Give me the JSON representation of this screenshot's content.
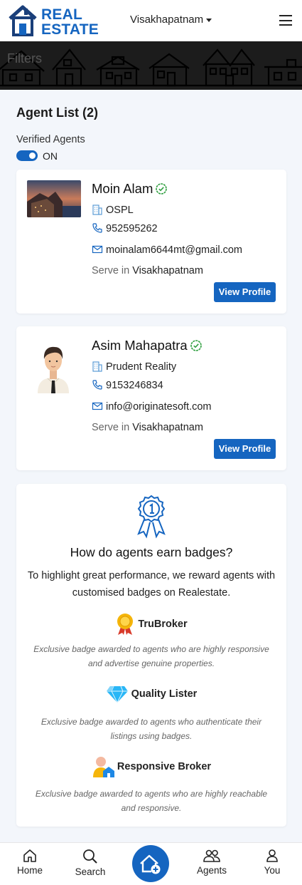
{
  "header": {
    "logo_line1": "REAL",
    "logo_line2": "ESTATE",
    "city": "Visakhapatnam"
  },
  "banner": {
    "filters_label": "Filters"
  },
  "list": {
    "title": "Agent List (2)",
    "verified_label": "Verified Agents",
    "toggle_state": "ON"
  },
  "agents": [
    {
      "name": "Moin Alam",
      "company": "OSPL",
      "phone": "952595262",
      "email": "moinalam6644mt@gmail.com",
      "serve_prefix": "Serve in",
      "serve_city": "Visakhapatnam",
      "button": "View Profile"
    },
    {
      "name": "Asim Mahapatra",
      "company": "Prudent Reality",
      "phone": "9153246834",
      "email": "info@originatesoft.com",
      "serve_prefix": "Serve in",
      "serve_city": "Visakhapatnam",
      "button": "View Profile"
    }
  ],
  "badges": {
    "title": "How do agents earn badges?",
    "description": "To highlight great performance, we reward agents with customised badges on Realestate.",
    "items": [
      {
        "name": "TruBroker",
        "text": "Exclusive badge awarded to agents who are highly responsive and advertise genuine properties."
      },
      {
        "name": "Quality Lister",
        "text": "Exclusive badge awarded to agents who authenticate their listings using badges."
      },
      {
        "name": "Responsive Broker",
        "text": "Exclusive badge awarded to agents who are highly reachable and responsive."
      }
    ]
  },
  "nav": {
    "home": "Home",
    "search": "Search",
    "agents": "Agents",
    "you": "You"
  },
  "colors": {
    "accent": "#1565c0",
    "verified": "#2e9e3e"
  }
}
